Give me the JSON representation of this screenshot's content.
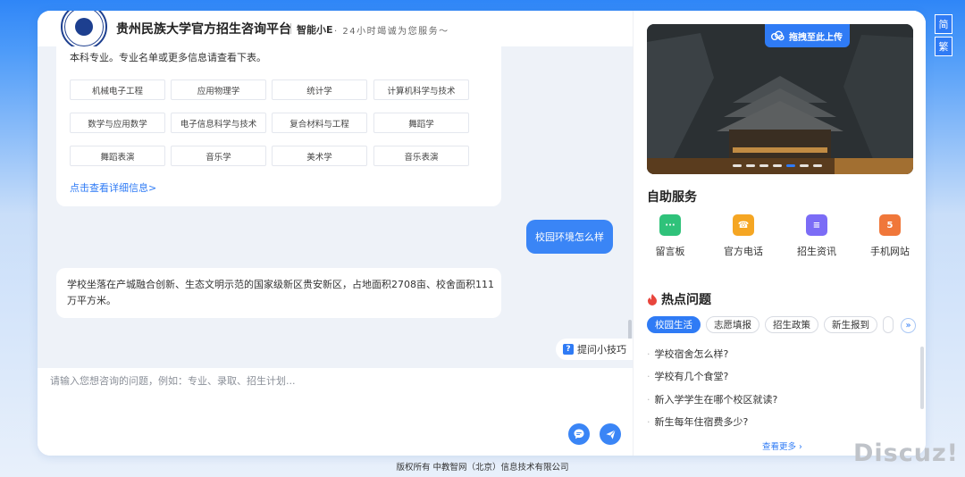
{
  "header": {
    "title": "贵州民族大学官方招生咨询平台",
    "brand": "智能小E",
    "slogan": "· 24小时竭诚为您服务～"
  },
  "chat": {
    "intro": "本科专业。专业名单或更多信息请查看下表。",
    "majors": [
      "机械电子工程",
      "应用物理学",
      "统计学",
      "计算机科学与技术",
      "数学与应用数学",
      "电子信息科学与技术",
      "复合材料与工程",
      "舞蹈学",
      "舞蹈表演",
      "音乐学",
      "美术学",
      "音乐表演"
    ],
    "more_link": "点击查看详细信息>",
    "user_message": "校园环境怎么样",
    "answer": "学校坐落在产城融合创新、生态文明示范的国家级新区贵安新区，占地面积2708亩、校舍面积111万平方米。",
    "tips": "提问小技巧"
  },
  "input": {
    "placeholder": "请输入您想咨询的问题，例如：专业、录取、招生计划..."
  },
  "right": {
    "upload_label": "拖拽至此上传",
    "carousel_dots": 7,
    "carousel_active": 4,
    "services_title": "自助服务",
    "services": [
      {
        "label": "留言板",
        "icon": "message-board-icon",
        "color": "#2fc27a"
      },
      {
        "label": "官方电话",
        "icon": "phone-icon",
        "color": "#f5a623"
      },
      {
        "label": "招生资讯",
        "icon": "news-icon",
        "color": "#7b6cf6"
      },
      {
        "label": "手机网站",
        "icon": "html5-icon",
        "color": "#f0773a"
      }
    ],
    "hot_title": "热点问题",
    "hot_tabs": [
      "校园生活",
      "志愿填报",
      "招生政策",
      "新生报到"
    ],
    "hot_questions": [
      "学校宿舍怎么样?",
      "学校有几个食堂?",
      "新入学学生在哪个校区就读?",
      "新生每年住宿费多少?"
    ],
    "see_more": "查看更多"
  },
  "lang": {
    "simplified": "简",
    "traditional": "繁"
  },
  "footer": "版权所有  中教智网（北京）信息技术有限公司",
  "watermark": "Discuz!",
  "colors": {
    "accent": "#2f7bf5",
    "background": "#eef2f8"
  }
}
